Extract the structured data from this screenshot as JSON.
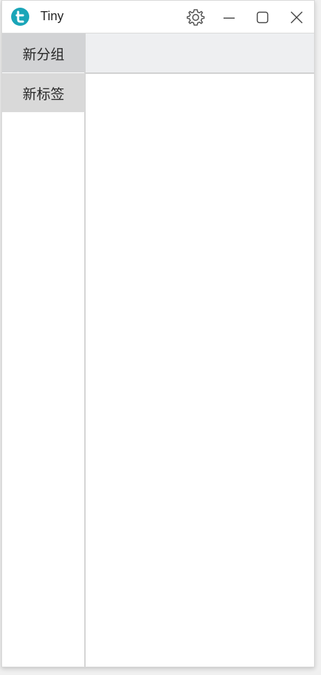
{
  "window": {
    "title": "Tiny",
    "accent_color": "#1aa5b8",
    "controls": {
      "settings_icon": "gear-icon",
      "minimize_icon": "minimize-icon",
      "maximize_icon": "maximize-icon",
      "close_icon": "close-icon"
    }
  },
  "sidebar": {
    "items": [
      {
        "label": "新分组"
      },
      {
        "label": "新标签"
      }
    ]
  }
}
